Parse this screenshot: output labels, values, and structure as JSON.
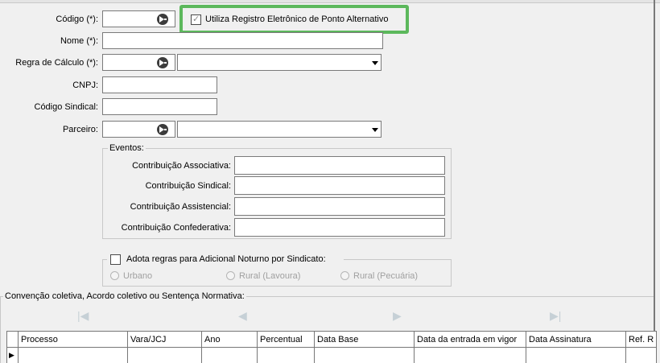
{
  "form": {
    "codigo_label": "Código (*):",
    "codigo_value": "",
    "alt_checkbox_label": "Utiliza Registro Eletrônico de Ponto Alternativo",
    "alt_checkbox_checked": true,
    "nome_label": "Nome (*):",
    "nome_value": "",
    "regra_label": "Regra de Cálculo (*):",
    "regra_code_value": "",
    "regra_selected": "",
    "cnpj_label": "CNPJ:",
    "cnpj_value": "",
    "codigo_sindical_label": "Código Sindical:",
    "codigo_sindical_value": "",
    "parceiro_label": "Parceiro:",
    "parceiro_code_value": "",
    "parceiro_selected": ""
  },
  "eventos": {
    "title": "Eventos:",
    "associativa_label": "Contribuição Associativa:",
    "sindical_label": "Contribuição Sindical:",
    "assistencial_label": "Contribuição Assistencial:",
    "confederativa_label": "Contribuição Confederativa:"
  },
  "adicional": {
    "checkbox_label": "Adota regras para Adicional Noturno por Sindicato:",
    "checked": false,
    "radio_urbano": "Urbano",
    "radio_lavoura": "Rural (Lavoura)",
    "radio_pecuaria": "Rural (Pecuária)"
  },
  "convencao": {
    "title": "Convenção coletiva, Acordo coletivo ou Sentença Normativa:",
    "columns": [
      "Processo",
      "Vara/JCJ",
      "Ano",
      "Percentual",
      "Data Base",
      "Data da entrada em vigor",
      "Data Assinatura",
      "Ref. R"
    ]
  },
  "icons": {
    "lookup": "lookup-arrow-icon",
    "first": "first-record-icon",
    "prev": "previous-record-icon",
    "next": "next-record-icon",
    "last": "last-record-icon"
  },
  "colors": {
    "highlight": "#5cb85c"
  }
}
